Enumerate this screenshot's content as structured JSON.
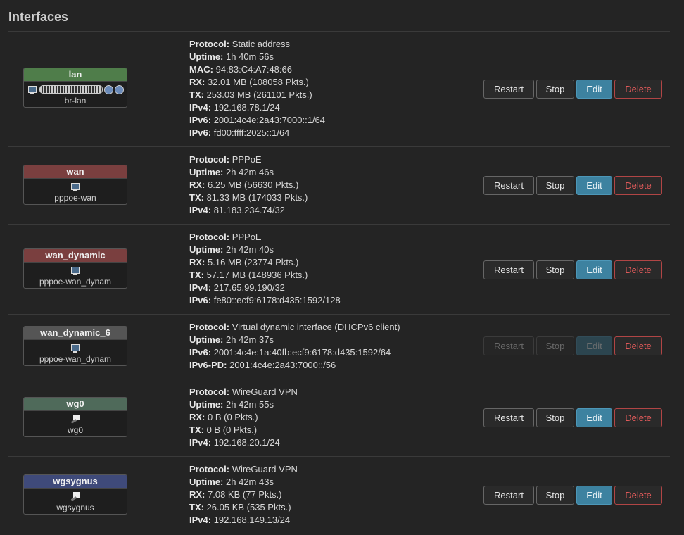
{
  "page": {
    "title": "Interfaces"
  },
  "buttons": {
    "restart": "Restart",
    "stop": "Stop",
    "edit": "Edit",
    "delete": "Delete"
  },
  "interfaces": [
    {
      "name": "lan",
      "device": "br-lan",
      "color": "#4f7d4a",
      "icons": [
        "network-icon",
        "bridge-ports-icon",
        "wireless-icon",
        "wireless-icon"
      ],
      "details": [
        {
          "label": "Protocol:",
          "value": "Static address"
        },
        {
          "label": "Uptime:",
          "value": "1h 40m 56s"
        },
        {
          "label": "MAC:",
          "value": "94:83:C4:A7:48:66"
        },
        {
          "label": "RX:",
          "value": "32.01 MB (108058 Pkts.)"
        },
        {
          "label": "TX:",
          "value": "253.03 MB (261101 Pkts.)"
        },
        {
          "label": "IPv4:",
          "value": "192.168.78.1/24"
        },
        {
          "label": "IPv6:",
          "value": "2001:4c4e:2a43:7000::1/64"
        },
        {
          "label": "IPv6:",
          "value": "fd00:ffff:2025::1/64"
        }
      ],
      "disabled": false
    },
    {
      "name": "wan",
      "device": "pppoe-wan",
      "color": "#7a3f3f",
      "icons": [
        "network-icon"
      ],
      "details": [
        {
          "label": "Protocol:",
          "value": "PPPoE"
        },
        {
          "label": "Uptime:",
          "value": "2h 42m 46s"
        },
        {
          "label": "RX:",
          "value": "6.25 MB (56630 Pkts.)"
        },
        {
          "label": "TX:",
          "value": "81.33 MB (174033 Pkts.)"
        },
        {
          "label": "IPv4:",
          "value": "81.183.234.74/32"
        }
      ],
      "disabled": false
    },
    {
      "name": "wan_dynamic",
      "device": "pppoe-wan_dynam",
      "color": "#7a3f3f",
      "icons": [
        "network-icon"
      ],
      "details": [
        {
          "label": "Protocol:",
          "value": "PPPoE"
        },
        {
          "label": "Uptime:",
          "value": "2h 42m 40s"
        },
        {
          "label": "RX:",
          "value": "5.16 MB (23774 Pkts.)"
        },
        {
          "label": "TX:",
          "value": "57.17 MB (148936 Pkts.)"
        },
        {
          "label": "IPv4:",
          "value": "217.65.99.190/32"
        },
        {
          "label": "IPv6:",
          "value": "fe80::ecf9:6178:d435:1592/128"
        }
      ],
      "disabled": false
    },
    {
      "name": "wan_dynamic_6",
      "device": "pppoe-wan_dynam",
      "color": "#555555",
      "icons": [
        "network-icon"
      ],
      "details": [
        {
          "label": "Protocol:",
          "value": "Virtual dynamic interface (DHCPv6 client)"
        },
        {
          "label": "Uptime:",
          "value": "2h 42m 37s"
        },
        {
          "label": "IPv6:",
          "value": "2001:4c4e:1a:40fb:ecf9:6178:d435:1592/64"
        },
        {
          "label": "IPv6-PD:",
          "value": "2001:4c4e:2a43:7000::/56"
        }
      ],
      "disabled": true
    },
    {
      "name": "wg0",
      "device": "wg0",
      "color": "#4f6a5a",
      "icons": [
        "tunnel-icon"
      ],
      "details": [
        {
          "label": "Protocol:",
          "value": "WireGuard VPN"
        },
        {
          "label": "Uptime:",
          "value": "2h 42m 55s"
        },
        {
          "label": "RX:",
          "value": "0 B (0 Pkts.)"
        },
        {
          "label": "TX:",
          "value": "0 B (0 Pkts.)"
        },
        {
          "label": "IPv4:",
          "value": "192.168.20.1/24"
        }
      ],
      "disabled": false
    },
    {
      "name": "wgsygnus",
      "device": "wgsygnus",
      "color": "#3f4a7a",
      "icons": [
        "tunnel-icon"
      ],
      "details": [
        {
          "label": "Protocol:",
          "value": "WireGuard VPN"
        },
        {
          "label": "Uptime:",
          "value": "2h 42m 43s"
        },
        {
          "label": "RX:",
          "value": "7.08 KB (77 Pkts.)"
        },
        {
          "label": "TX:",
          "value": "26.05 KB (535 Pkts.)"
        },
        {
          "label": "IPv4:",
          "value": "192.168.149.13/24"
        }
      ],
      "disabled": false
    }
  ]
}
